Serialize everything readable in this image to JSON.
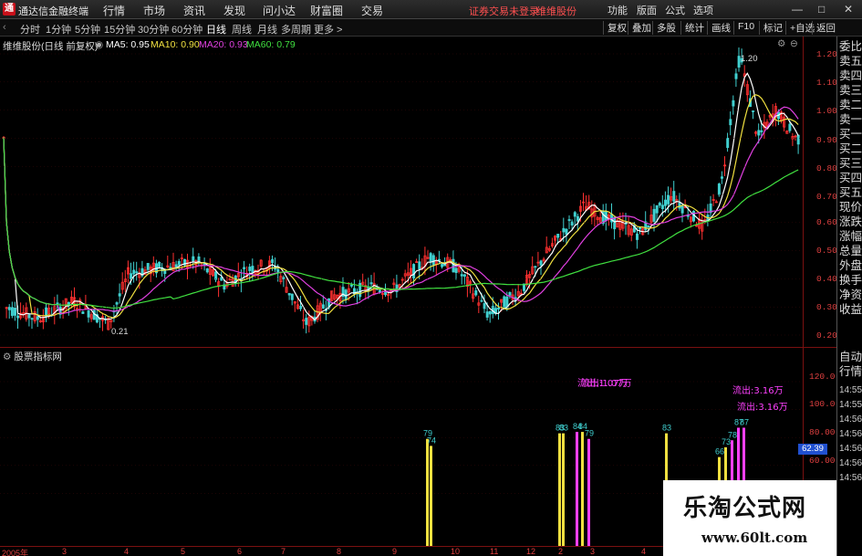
{
  "menubar": {
    "logo": "通",
    "title": "通达信金融终端",
    "items": [
      "行情",
      "市场",
      "资讯",
      "发现",
      "问小达",
      "财富圈",
      "交易"
    ],
    "warning": "证券交易未登录",
    "stock_name": "维维股份",
    "right_items": [
      "功能",
      "版面",
      "公式",
      "选项"
    ],
    "window_buttons": [
      "—",
      "□",
      "✕"
    ]
  },
  "toolbar": {
    "periods": [
      "分时",
      "1分钟",
      "5分钟",
      "15分钟",
      "30分钟",
      "60分钟",
      "日线",
      "周线",
      "月线",
      "多周期",
      "更多 >"
    ],
    "active_period": "日线",
    "right_items": [
      "复权",
      "叠加",
      "多股",
      "统计",
      "画线",
      "F10",
      "标记",
      "+自选",
      "返回"
    ]
  },
  "main_chart": {
    "title": "维维股份(日线 前复权)",
    "ma": [
      {
        "label": "MA5: 0.95",
        "color": "#ffffff"
      },
      {
        "label": "MA10: 0.90",
        "color": "#f0e040"
      },
      {
        "label": "MA20: 0.93",
        "color": "#e040e0"
      },
      {
        "label": "MA60: 0.79",
        "color": "#40e040"
      }
    ],
    "y_ticks": [
      "1.20",
      "1.10",
      "1.00",
      "0.90",
      "0.80",
      "0.70",
      "0.60",
      "0.50",
      "0.40",
      "0.30",
      "0.20"
    ],
    "high_label": "1.20",
    "low_label": "0.21"
  },
  "indicator": {
    "title": "股票指标网",
    "y_ticks": [
      "120.0",
      "100.0",
      "80.00",
      "60.00"
    ],
    "current_value": "62.39",
    "bar_labels": [
      "79",
      "74",
      "83",
      "83",
      "84",
      "84",
      "79",
      "83",
      "66",
      "73",
      "78",
      "87",
      "87"
    ],
    "annotations": [
      "流出:1.07万",
      "流出:1.07万",
      "流出:3.16万",
      "流出:3.16万"
    ]
  },
  "sidebar": {
    "items": [
      "委比",
      "卖五",
      "卖四",
      "卖三",
      "卖二",
      "卖一",
      "买一",
      "买二",
      "买三",
      "买四",
      "买五",
      "现价",
      "涨跌",
      "涨幅",
      "总量",
      "外盘",
      "换手",
      "净资",
      "收益",
      "自动",
      "行情",
      "14:55",
      "14:55",
      "14:56",
      "14:56",
      "14:56",
      "14:56",
      "14:56"
    ]
  },
  "dates": [
    "2005年",
    "3",
    "4",
    "5",
    "6",
    "7",
    "8",
    "9",
    "10",
    "11",
    "12",
    "2",
    "3",
    "4"
  ],
  "watermark": {
    "main": "乐淘公式网",
    "sub": "www.60lt.com"
  },
  "colors": {
    "up": "#ff3030",
    "down": "#40d0d0",
    "ma5": "#ffffff",
    "ma10": "#f0e040",
    "ma20": "#e040e0",
    "ma60": "#40e040",
    "axis": "#e04040"
  }
}
